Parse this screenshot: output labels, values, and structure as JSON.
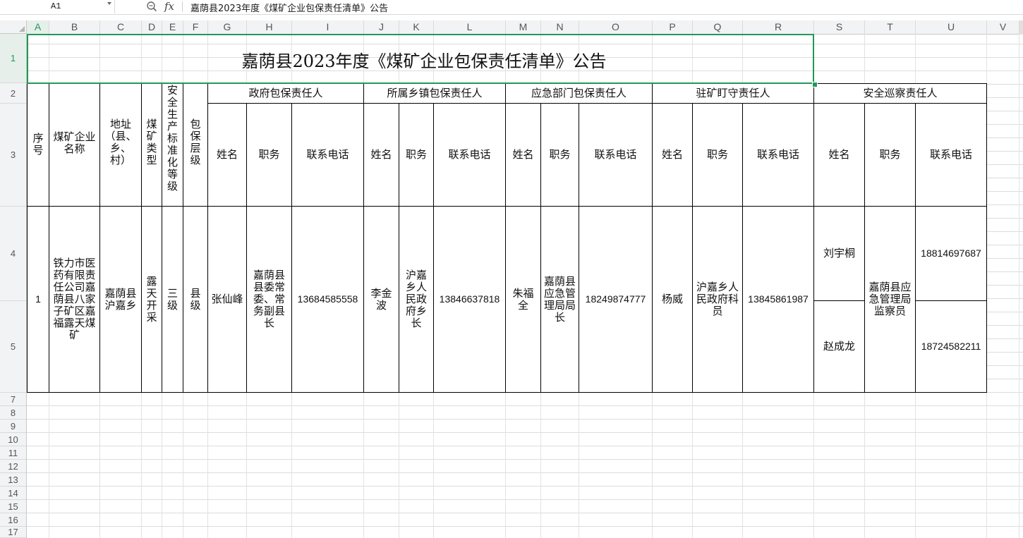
{
  "formula_bar": {
    "name_box": "A1",
    "fx_label": "fx",
    "formula": "嘉荫县2023年度《煤矿企业包保责任清单》公告"
  },
  "columns": [
    "A",
    "B",
    "C",
    "D",
    "E",
    "F",
    "G",
    "H",
    "I",
    "J",
    "K",
    "L",
    "M",
    "N",
    "O",
    "P",
    "Q",
    "R",
    "S",
    "T",
    "U",
    "V"
  ],
  "rows": [
    "1",
    "2",
    "3",
    "4",
    "5",
    "7",
    "8",
    "9",
    "10",
    "11",
    "12",
    "13",
    "14",
    "15",
    "16",
    "17"
  ],
  "sheet": {
    "title": "嘉荫县2023年度《煤矿企业包保责任清单》公告",
    "headers": {
      "seq": "序号",
      "company": "煤矿企业名称",
      "address": "地址（县、乡、村）",
      "mine_type": "煤矿类型",
      "safety_grade": "安全生产标准化等级",
      "guarantee_level": "包保层级",
      "groups": [
        "政府包保责任人",
        "所属乡镇包保责任人",
        "应急部门包保责任人",
        "驻矿盯守责任人",
        "安全巡察责任人"
      ],
      "name": "姓名",
      "position": "职务",
      "phone": "联系电话"
    },
    "record": {
      "seq": "1",
      "company": "铁力市医药有限责任公司嘉荫县八家子矿区嘉福露天煤矿",
      "address": "嘉荫县沪嘉乡",
      "mine_type": "露天开采",
      "safety_grade": "三级",
      "guarantee_level": "县级",
      "gov": {
        "name": "张仙峰",
        "position": "嘉荫县县委常委、常务副县长",
        "phone": "13684585558"
      },
      "town": {
        "name": "李金波",
        "position": "沪嘉乡人民政府乡长",
        "phone": "13846637818"
      },
      "emergency": {
        "name": "朱福全",
        "position": "嘉荫县应急管理局局长",
        "phone": "18249874777"
      },
      "onsite": {
        "name": "杨威",
        "position": "沪嘉乡人民政府科员",
        "phone": "13845861987"
      },
      "patrol": {
        "name1": "刘宇桐",
        "phone1": "18814697687",
        "name2": "赵成龙",
        "phone2": "18724582211",
        "position": "嘉荫县应急管理局监察员"
      }
    }
  }
}
